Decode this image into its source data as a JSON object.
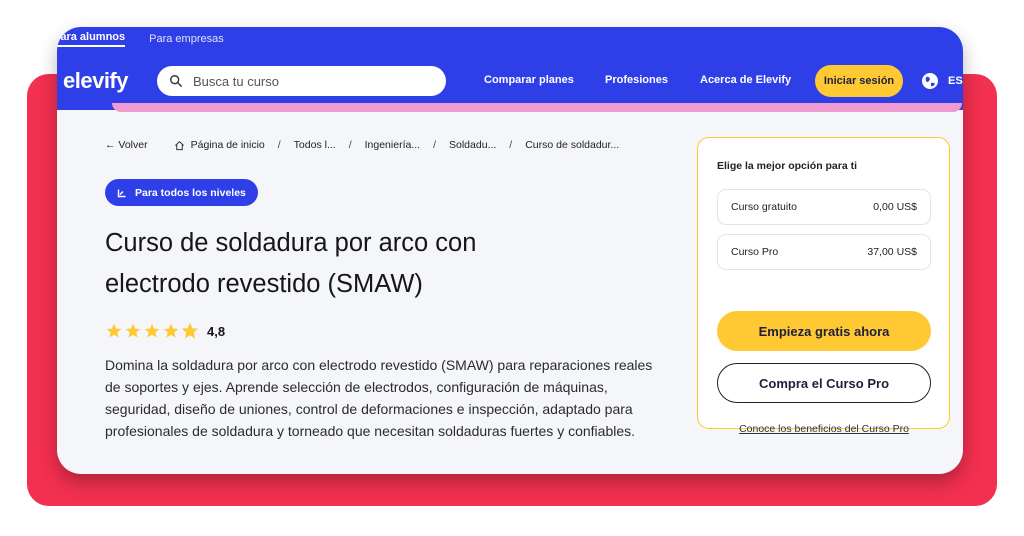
{
  "header": {
    "audience_active": "Para alumnos",
    "audience_other": "Para empresas",
    "logo": "elevify",
    "search_placeholder": "Busca tu curso",
    "nav": [
      "Comparar planes",
      "Profesiones",
      "Acerca de Elevify"
    ],
    "login_label": "Iniciar sesión",
    "language": "ES",
    "colors": {
      "brand_blue": "#2f3fe8",
      "accent_yellow": "#ffc933",
      "frame_red": "#f2304f"
    }
  },
  "breadcrumb": {
    "back": "Volver",
    "items": [
      "Página de inicio",
      "Todos l...",
      "Ingeniería...",
      "Soldadu...",
      "Curso de soldadur..."
    ]
  },
  "course": {
    "level_badge": "Para todos los niveles",
    "title_line1": "Curso de soldadura por arco con",
    "title_line2": "electrodo revestido (SMAW)",
    "rating": "4,8",
    "rating_value": 4.8,
    "description": "Domina la soldadura por arco con electrodo revestido (SMAW) para reparaciones reales de soportes y ejes. Aprende selección de electrodos, configuración de máquinas, seguridad, diseño de uniones, control de deformaciones e inspección, adaptado para profesionales de soldadura y torneado que necesitan soldaduras fuertes y confiables."
  },
  "pricing": {
    "heading": "Elige la mejor opción para ti",
    "options": [
      {
        "label": "Curso gratuito",
        "price": "0,00 US$"
      },
      {
        "label": "Curso Pro",
        "price": "37,00 US$"
      }
    ],
    "primary_cta": "Empieza gratis ahora",
    "secondary_cta": "Compra el Curso Pro",
    "benefits_link": "Conoce los beneficios del Curso Pro"
  }
}
